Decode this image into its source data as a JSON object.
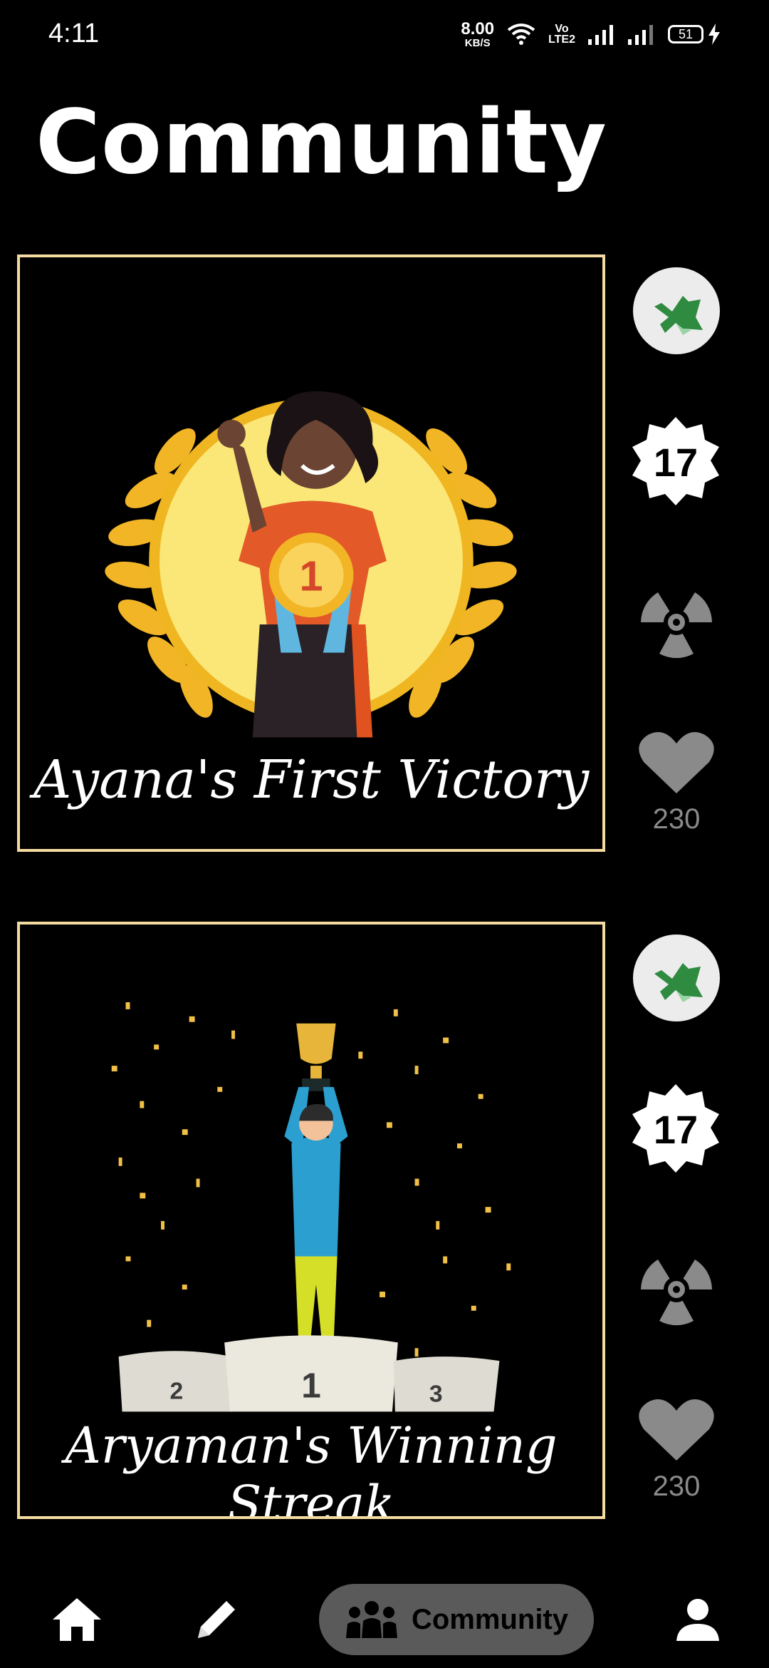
{
  "status_bar": {
    "time": "4:11",
    "net_speed_value": "8.00",
    "net_speed_unit": "KB/S",
    "volte_top": "Vo",
    "volte_bottom": "LTE2",
    "battery": "51"
  },
  "header": {
    "title": "Community"
  },
  "posts": [
    {
      "caption": "Ayana's First Victory",
      "badge": "17",
      "likes": "230"
    },
    {
      "caption": "Aryaman's Winning Streak",
      "badge": "17",
      "likes": "230"
    }
  ],
  "podium": {
    "first": "1",
    "second": "2",
    "third": "3"
  },
  "nav": {
    "community_label": "Community"
  },
  "colors": {
    "card_border": "#f4dba0",
    "gold": "#f2b526",
    "muted_icon": "#8a8a8a",
    "active_nav_bg": "#5a5a5a"
  }
}
